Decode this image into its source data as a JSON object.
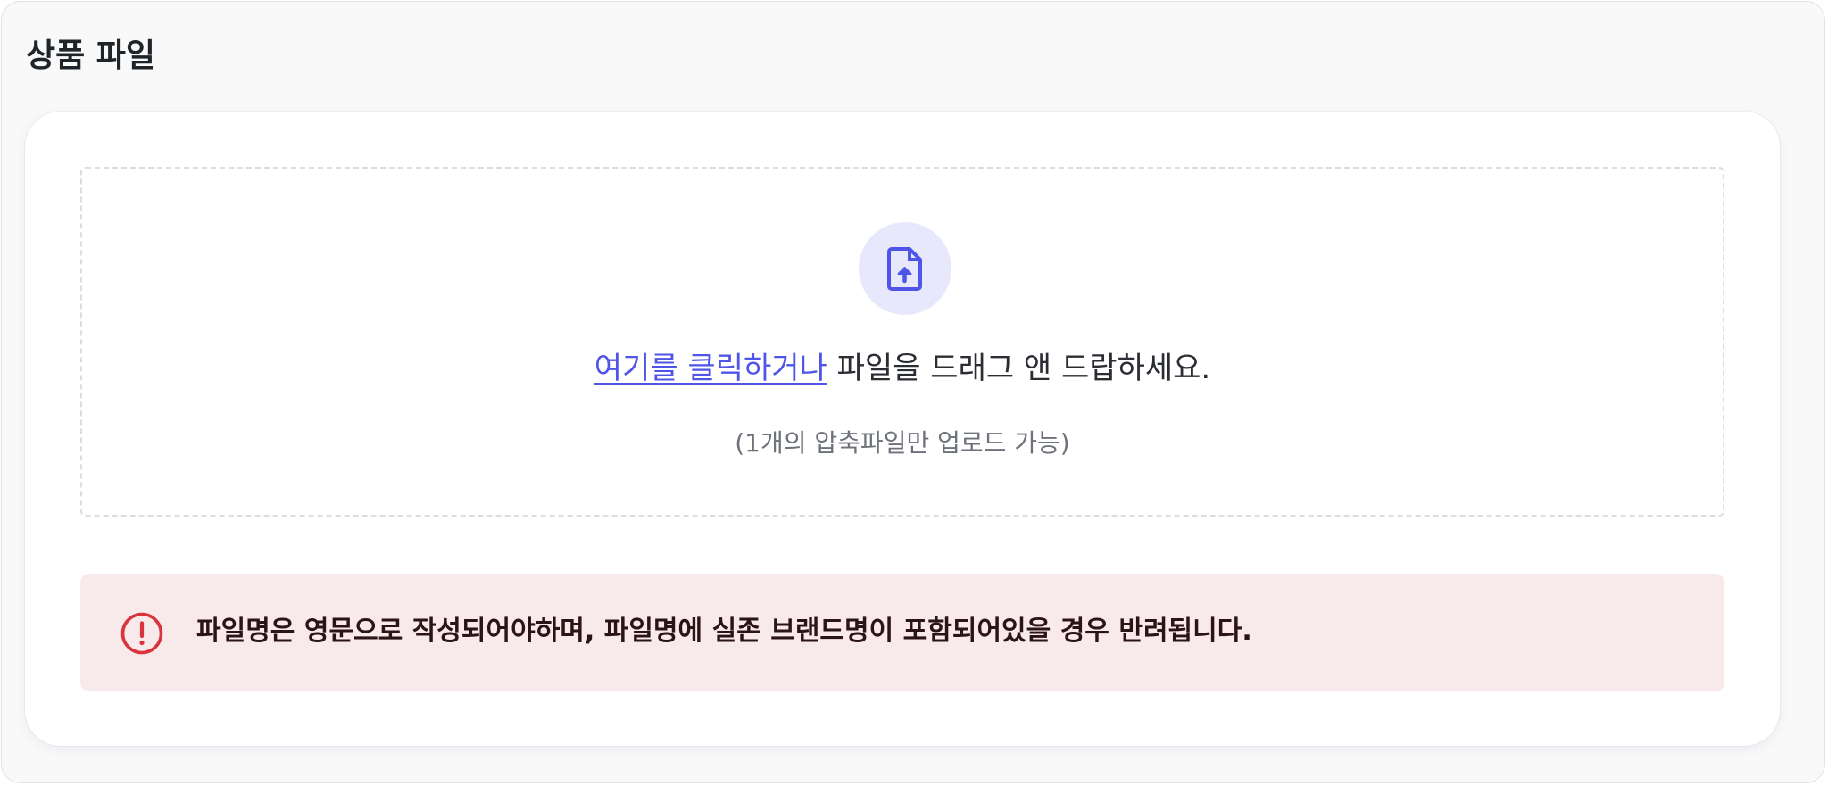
{
  "section": {
    "title": "상품 파일"
  },
  "upload": {
    "icon": "file-upload-icon",
    "link_text": "여기를 클릭하거나",
    "instruction_rest": " 파일을 드래그 앤 드랍하세요.",
    "hint": "(1개의 압축파일만 업로드 가능)"
  },
  "alert": {
    "icon": "exclamation-circle-icon",
    "message": "파일명은 영문으로 작성되어야하며, 파일명에 실존 브랜드명이 포함되어있을 경우 반려됩니다."
  },
  "colors": {
    "accent": "#4f55e6",
    "icon_bg": "#e8e8fd",
    "alert_bg": "#f8e9ea",
    "alert_icon": "#d8343d",
    "title_text": "#1f2429"
  }
}
